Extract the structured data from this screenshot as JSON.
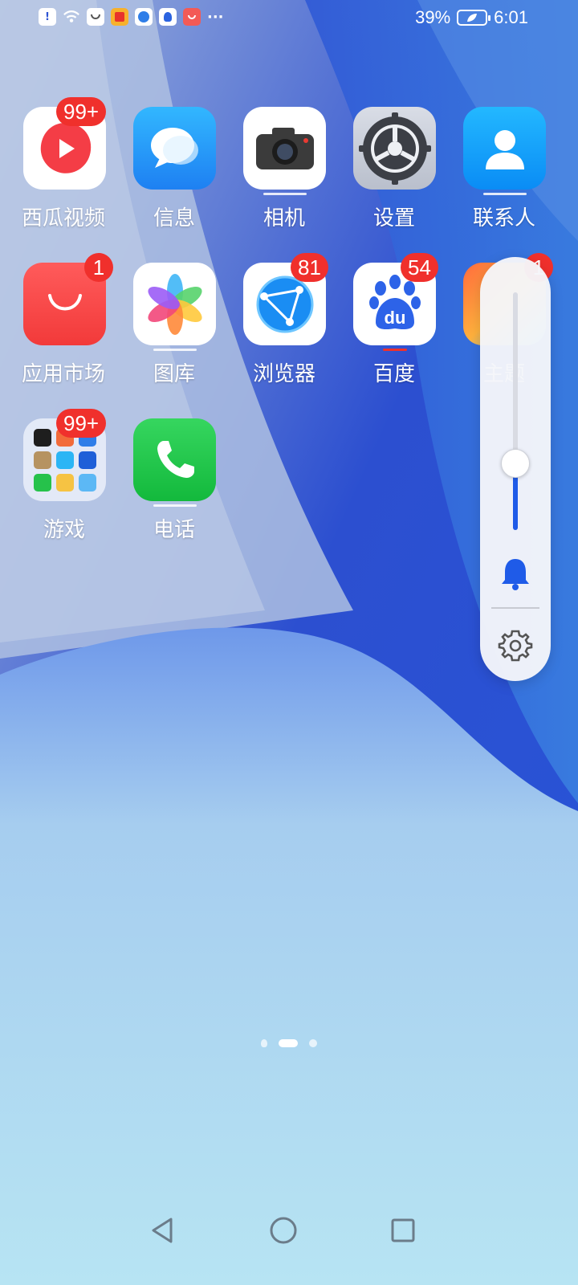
{
  "status_bar": {
    "battery": "39%",
    "time": "6:01",
    "more": "···",
    "notification_icons": [
      "alert-icon",
      "wifi-icon",
      "bag-icon",
      "app-icon",
      "browser-icon",
      "bulb-icon",
      "store-icon"
    ]
  },
  "apps": [
    {
      "label": "西瓜视频",
      "badge": "99+",
      "icon": "xigua-icon"
    },
    {
      "label": "信息",
      "badge": "",
      "icon": "messages-icon"
    },
    {
      "label": "相机",
      "badge": "",
      "icon": "camera-icon"
    },
    {
      "label": "设置",
      "badge": "",
      "icon": "settings-icon"
    },
    {
      "label": "联系人",
      "badge": "",
      "icon": "contacts-icon"
    },
    {
      "label": "应用市场",
      "badge": "1",
      "icon": "appmarket-icon"
    },
    {
      "label": "图库",
      "badge": "",
      "icon": "gallery-icon"
    },
    {
      "label": "浏览器",
      "badge": "81",
      "icon": "browser-icon"
    },
    {
      "label": "百度",
      "badge": "54",
      "icon": "baidu-icon"
    },
    {
      "label": "主题",
      "badge": "1",
      "icon": "themes-icon"
    },
    {
      "label": "游戏",
      "badge": "99+",
      "icon": "games-folder-icon"
    },
    {
      "label": "电话",
      "badge": "",
      "icon": "phone-icon"
    }
  ],
  "volume": {
    "level": 0.28,
    "mode_icon": "bell-icon",
    "settings_icon": "gear-icon"
  },
  "page_indicator": {
    "pages": 3,
    "current": 2
  },
  "nav": {
    "back": "back-icon",
    "home": "home-icon",
    "recents": "recents-icon"
  },
  "colors": {
    "badge": "#f0302c",
    "accent": "#1f5be8"
  }
}
